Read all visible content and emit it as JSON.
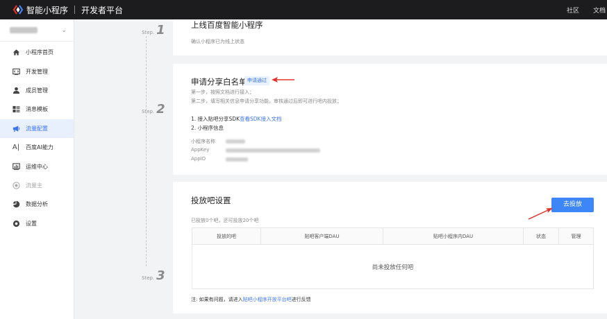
{
  "header": {
    "brand": "智能小程序",
    "platform": "开发者平台",
    "nav": [
      "社区",
      "文档"
    ]
  },
  "sidebar": {
    "items": [
      {
        "label": "小程序首页",
        "icon": "home-icon"
      },
      {
        "label": "开发管理",
        "icon": "code-icon"
      },
      {
        "label": "成员管理",
        "icon": "user-icon"
      },
      {
        "label": "消息模板",
        "icon": "template-icon"
      },
      {
        "label": "流量配置",
        "icon": "megaphone-icon",
        "active": true
      },
      {
        "label": "百度AI能力",
        "icon": "ai-icon"
      },
      {
        "label": "运维中心",
        "icon": "monitor-icon"
      },
      {
        "label": "流量主",
        "icon": "coin-icon",
        "disabled": true
      },
      {
        "label": "数据分析",
        "icon": "pie-chart-icon"
      },
      {
        "label": "设置",
        "icon": "gear-icon"
      }
    ]
  },
  "steps": {
    "label": "Step.",
    "nums": [
      "1",
      "2",
      "3"
    ]
  },
  "card1": {
    "title": "上线百度智能小程序",
    "subtitle": "确认小程序已为线上状态"
  },
  "card2": {
    "title": "申请分享白名单",
    "badge": "申请通过",
    "line1": "第一步，按照文档进行接入；",
    "line2": "第二步，填写相关信息申请分享功能，审核通过后即可进行吧内投放；",
    "item1_prefix": "1. 接入贴吧分享SDK",
    "item1_link": "查看SDK接入文档",
    "item2": "2. 小程序信息",
    "kv_name": "小程序名称",
    "kv_appkey": "AppKey",
    "kv_appid": "AppID"
  },
  "card3": {
    "title": "投放吧设置",
    "button": "去投放",
    "count_text": "已投放0个吧，还可投放20个吧",
    "columns": [
      "投放的吧",
      "贴吧客户端DAU",
      "贴吧小程序内DAU",
      "状态",
      "管理"
    ],
    "empty": "尚未投放任何吧",
    "note_prefix": "注: 如果有问题，请进入",
    "note_link": "贴吧小程序开放平台吧",
    "note_suffix": "进行反馈"
  },
  "colors": {
    "accent": "#3c86f7",
    "arrow": "#e0322b",
    "topbar": "#1c1c1e"
  }
}
